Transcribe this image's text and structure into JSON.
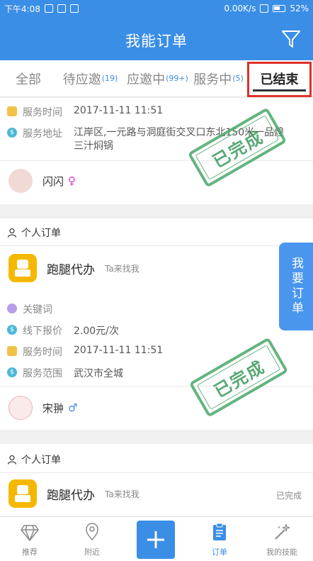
{
  "status_bar": {
    "time": "下午4:08",
    "network": "0.00K/s",
    "battery": "52%"
  },
  "header": {
    "title": "我能订单",
    "filter_icon": "filter-icon"
  },
  "tabs": [
    {
      "label": "全部",
      "count": ""
    },
    {
      "label": "待应邀",
      "count": "(19)"
    },
    {
      "label": "应邀中",
      "count": "(99+)"
    },
    {
      "label": "服务中",
      "count": "(5)"
    },
    {
      "label": "已结束",
      "count": ""
    }
  ],
  "order1": {
    "service_time_label": "服务时间",
    "service_time": "2017-11-11 11:51",
    "address_label": "服务地址",
    "address_line1": "江岸区,一元路与洞庭街交叉口东北150米一品煌",
    "address_line2": "三汁焖锅",
    "stamp": "已完成",
    "user_name": "闪闪",
    "user_gender": "♀"
  },
  "order2": {
    "section_label": "个人订单",
    "service_name": "跑腿代办",
    "service_sub": "Ta来找我",
    "keyword_label": "关键词",
    "price_label": "线下报价",
    "price": "2.00元/次",
    "service_time_label": "服务时间",
    "service_time": "2017-11-11 11:51",
    "range_label": "服务范围",
    "range": "武汉市全城",
    "stamp": "已完成",
    "user_name": "宋翀",
    "user_gender": "♂"
  },
  "order3": {
    "section_label": "个人订单",
    "service_name": "跑腿代办",
    "service_sub": "Ta来找我",
    "status": "已完成"
  },
  "float_button": "我要订单",
  "bottom_nav": [
    {
      "label": "推荐",
      "icon": "diamond-icon"
    },
    {
      "label": "附近",
      "icon": "location-icon"
    },
    {
      "label": "",
      "icon": "plus-icon"
    },
    {
      "label": "订单",
      "icon": "order-icon"
    },
    {
      "label": "我的技能",
      "icon": "wand-icon"
    }
  ],
  "colors": {
    "primary": "#3a8ee6",
    "stamp": "#4aa86a",
    "highlight": "#e0302a"
  }
}
